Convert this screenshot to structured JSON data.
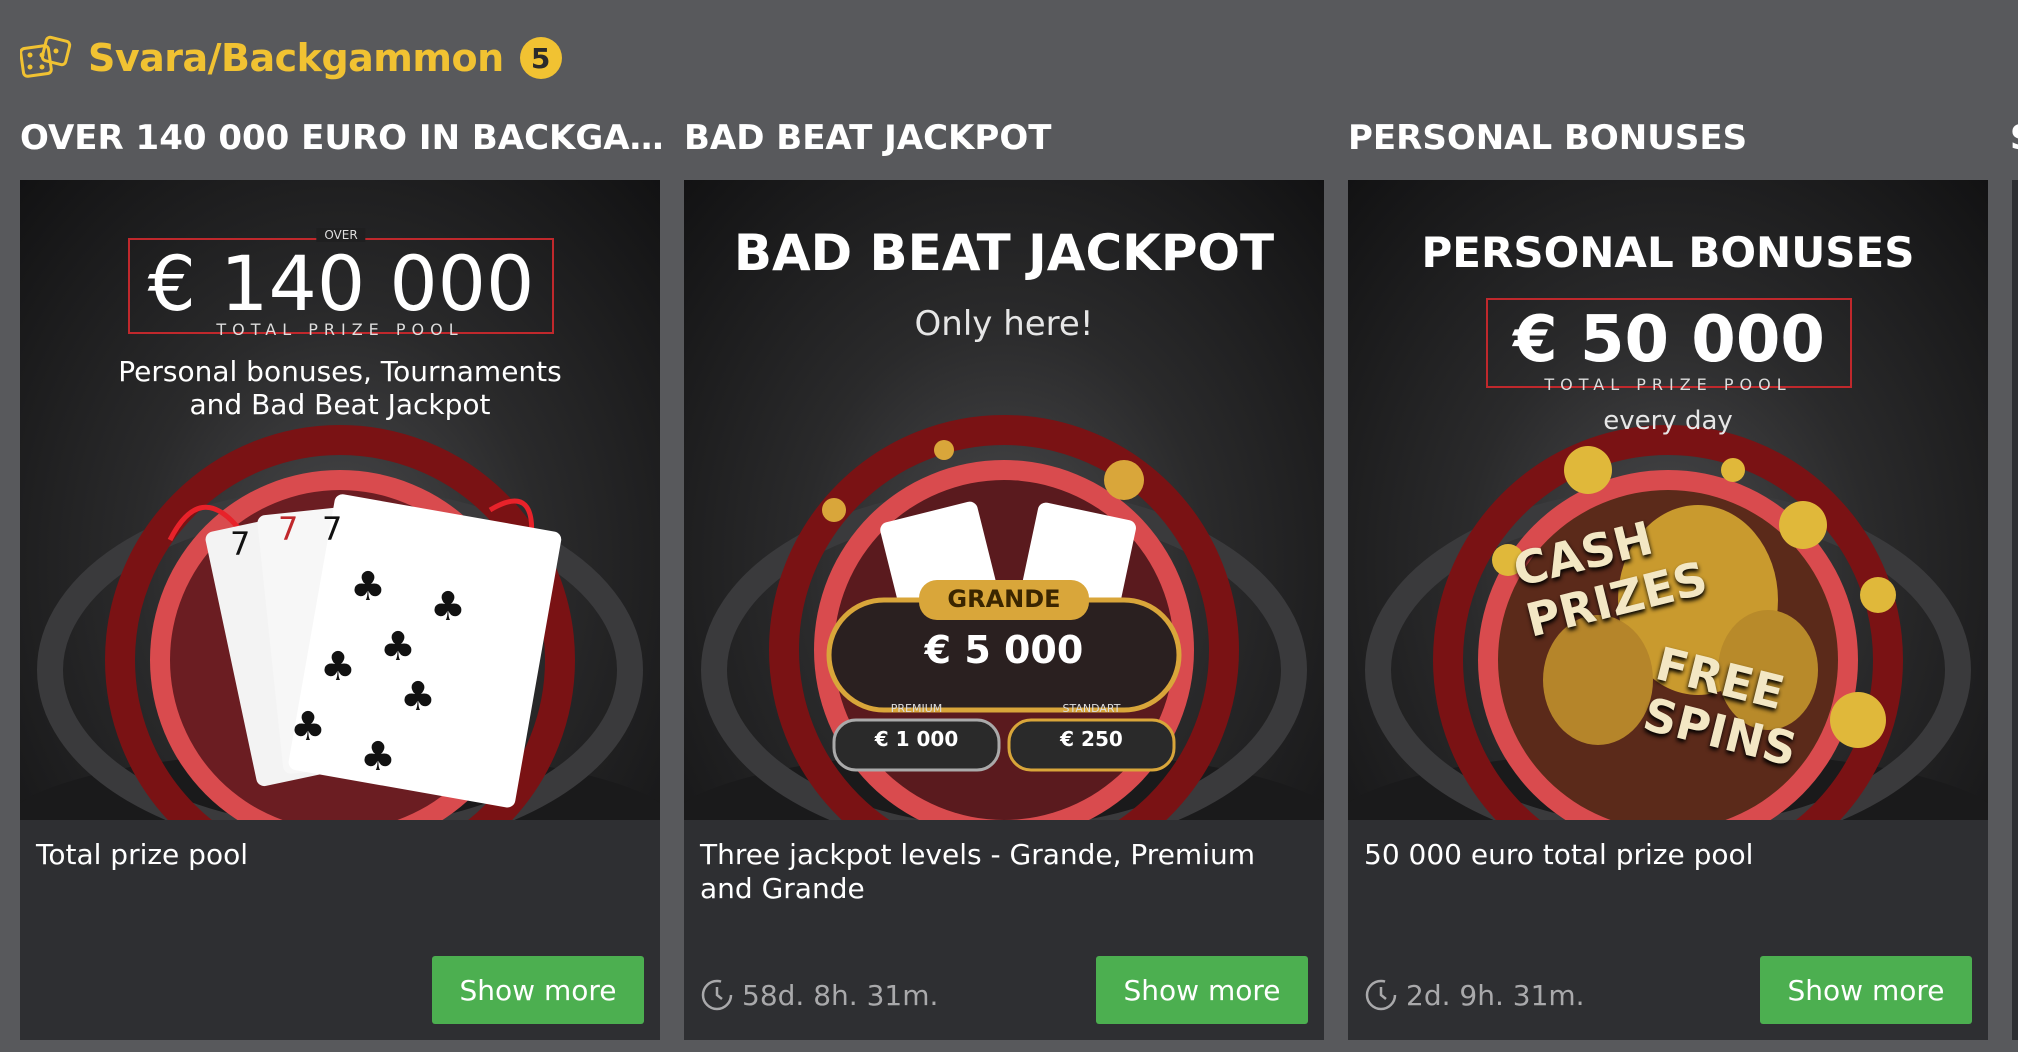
{
  "section": {
    "title": "Svara/Backgammon",
    "count": "5"
  },
  "cards": [
    {
      "title": "OVER 140 000 EURO IN BACKGAM...",
      "banner": {
        "over": "OVER",
        "amount": "€ 140 000",
        "pool_label": "TOTAL PRIZE POOL",
        "line1": "Personal bonuses, Tournaments",
        "line2": "and Bad Beat Jackpot"
      },
      "description": "Total prize pool",
      "timer": "",
      "button": "Show more"
    },
    {
      "title": "BAD BEAT JACKPOT",
      "banner": {
        "heading": "BAD BEAT JACKPOT",
        "sub": "Only here!",
        "grande_label": "GRANDE",
        "grande_value": "€ 5 000",
        "premium_label": "PREMIUM",
        "premium_value": "€ 1 000",
        "standart_label": "STANDART",
        "standart_value": "€ 250"
      },
      "description": "Three jackpot levels - Grande, Premium and Grande",
      "timer": "58d. 8h. 31m.",
      "button": "Show more"
    },
    {
      "title": "PERSONAL BONUSES",
      "banner": {
        "heading": "PERSONAL BONUSES",
        "amount": "€ 50 000",
        "pool_label": "TOTAL PRIZE POOL",
        "sub": "every day",
        "cash": "CASH PRIZES",
        "free": "FREE SPINS"
      },
      "description": "50 000 euro total prize pool",
      "timer": "2d. 9h. 31m.",
      "button": "Show more"
    }
  ],
  "colors": {
    "background": "#58595c",
    "accent": "#f1c232",
    "button": "#4caf50",
    "card": "#2e2f32"
  }
}
